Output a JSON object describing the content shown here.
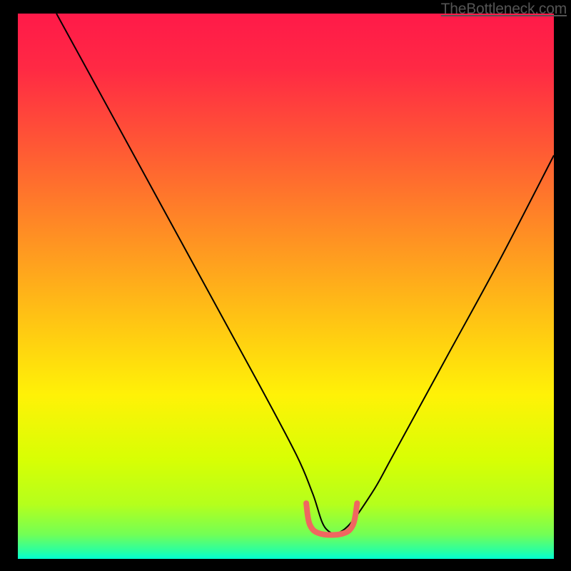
{
  "attribution": "TheBottleneck.com",
  "gradient": {
    "stops": [
      {
        "offset": 0.0,
        "color": "#ff1a49"
      },
      {
        "offset": 0.1,
        "color": "#ff2944"
      },
      {
        "offset": 0.25,
        "color": "#ff5a34"
      },
      {
        "offset": 0.4,
        "color": "#ff8d24"
      },
      {
        "offset": 0.55,
        "color": "#ffc015"
      },
      {
        "offset": 0.7,
        "color": "#fff207"
      },
      {
        "offset": 0.82,
        "color": "#d7ff04"
      },
      {
        "offset": 0.9,
        "color": "#b5ff1c"
      },
      {
        "offset": 0.955,
        "color": "#73ff55"
      },
      {
        "offset": 0.985,
        "color": "#2bffa0"
      },
      {
        "offset": 1.0,
        "color": "#02ffd2"
      }
    ]
  },
  "chart_data": {
    "type": "line",
    "title": "",
    "xlabel": "",
    "ylabel": "",
    "xlim": [
      0,
      100
    ],
    "ylim": [
      0,
      100
    ],
    "series": [
      {
        "name": "main-curve",
        "color": "#000000",
        "width": 2,
        "x": [
          7.2,
          15,
          25,
          35,
          45,
          52,
          55,
          57.5,
          61,
          66,
          70,
          80,
          90,
          100
        ],
        "y": [
          100,
          86,
          68,
          50,
          32,
          19,
          12,
          5.5,
          5.5,
          12,
          19,
          37,
          55,
          74
        ]
      },
      {
        "name": "flat-highlight",
        "color": "#ef6760",
        "width": 8,
        "cap": "round",
        "x": [
          53.8,
          54.5,
          56.5,
          60.5,
          62.5,
          63.3
        ],
        "y": [
          10.2,
          6.2,
          4.6,
          4.6,
          6.2,
          10.2
        ]
      }
    ]
  }
}
